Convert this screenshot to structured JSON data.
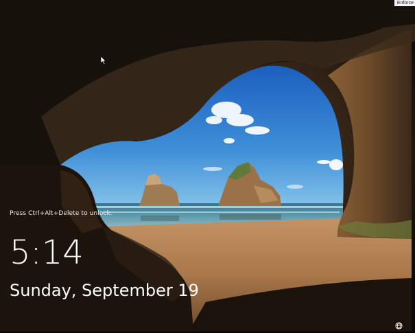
{
  "lockscreen": {
    "unlock_hint": "Press Ctrl+Alt+Delete to unlock.",
    "time": "5:14",
    "date": "Sunday, September 19"
  },
  "corner_badge": {
    "label": "Enforce"
  },
  "icons": {
    "network": "network-globe-icon",
    "cursor": "mouse-pointer-icon"
  },
  "colors": {
    "sky_top": "#1b64c4",
    "sky_bottom": "#6ab0e6",
    "sea": "#3f8fa8",
    "sand": "#b07f52",
    "cave": "#2a1e14"
  }
}
